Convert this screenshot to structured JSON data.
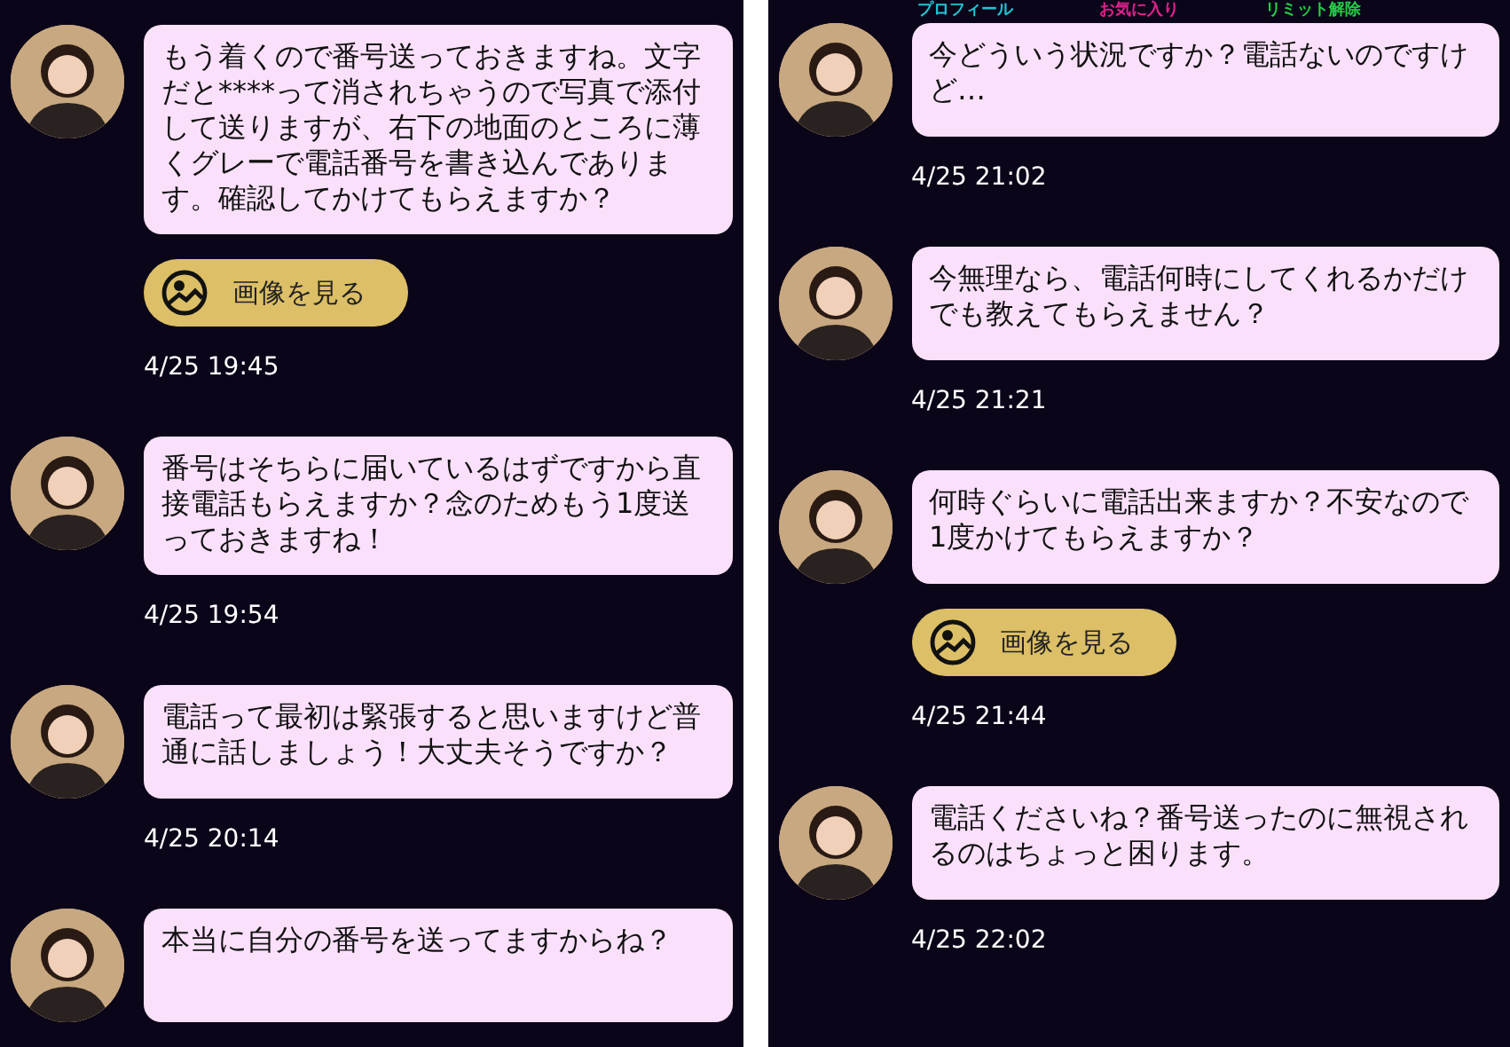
{
  "panels": [
    {
      "messages": [
        {
          "text": "もう着くので番号送っておきますね。文字だと****って消されちゃうので写真で添付して送りますが、右下の地面のところに薄くグレーで電話番号を書き込んであります。確認してかけてもらえますか？",
          "image_button": "画像を見る",
          "time": "4/25 19:45"
        },
        {
          "text": "番号はそちらに届いているはずですから直接電話もらえますか？念のためもう1度送っておきますね！",
          "time": "4/25 19:54"
        },
        {
          "text": "電話って最初は緊張すると思いますけど普通に話しましょう！大丈夫そうですか？",
          "time": "4/25 20:14"
        },
        {
          "text": "本当に自分の番号を送ってますからね？"
        }
      ]
    },
    {
      "header_tabs": [
        {
          "label": "プロフィール",
          "color": "#22c4d4"
        },
        {
          "label": "お気に入り",
          "color": "#e0208c"
        },
        {
          "label": "リミット解除",
          "color": "#22cc44"
        }
      ],
      "messages": [
        {
          "text": "今どういう状況ですか？電話ないのですけど…",
          "time": "4/25 21:02"
        },
        {
          "text": "今無理なら、電話何時にしてくれるかだけでも教えてもらえません？",
          "time": "4/25 21:21"
        },
        {
          "text": "何時ぐらいに電話出来ますか？不安なので1度かけてもらえますか？",
          "image_button": "画像を見る",
          "time": "4/25 21:44"
        },
        {
          "text": "電話くださいね？番号送ったのに無視されるのはちょっと困ります。",
          "time": "4/25 22:02"
        }
      ]
    }
  ]
}
